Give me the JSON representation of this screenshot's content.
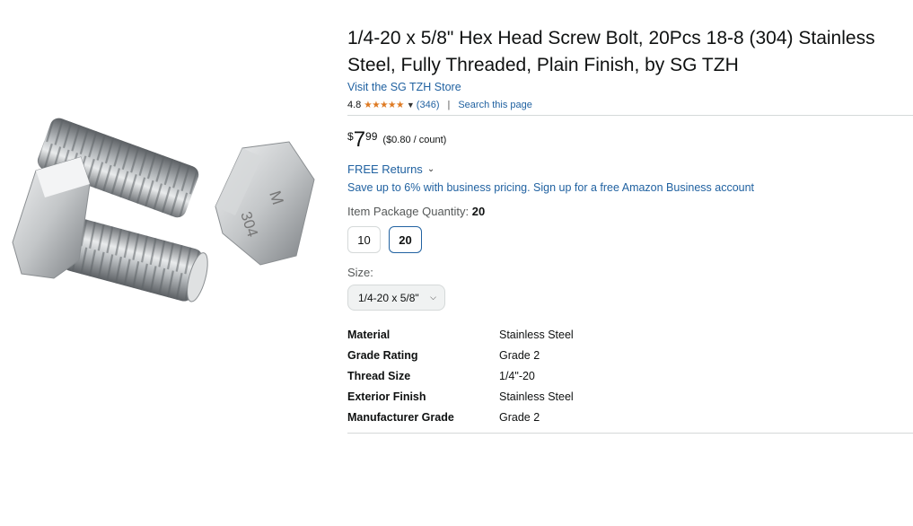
{
  "product": {
    "title": "1/4-20 x 5/8\" Hex Head Screw Bolt, 20Pcs 18-8 (304) Stainless Steel, Fully Threaded, Plain Finish, by SG TZH",
    "store_link": "Visit the SG TZH Store",
    "rating": "4.8",
    "stars": "★★★★★",
    "review_count": "(346)",
    "search_link": "Search this page",
    "image_markings": [
      "M",
      "304"
    ]
  },
  "price": {
    "symbol": "$",
    "whole": "7",
    "fraction": "99",
    "unit_price": "($0.80 / count)"
  },
  "returns": {
    "label": "FREE Returns"
  },
  "business": {
    "text": "Save up to 6% with business pricing. Sign up for a free Amazon Business account"
  },
  "quantity": {
    "label": "Item Package Quantity:",
    "selected": "20",
    "options": [
      "10",
      "20"
    ]
  },
  "size": {
    "label": "Size:",
    "selected": "1/4-20 x 5/8\""
  },
  "specs": [
    {
      "key": "Material",
      "value": "Stainless Steel"
    },
    {
      "key": "Grade Rating",
      "value": "Grade 2"
    },
    {
      "key": "Thread Size",
      "value": "1/4\"-20"
    },
    {
      "key": "Exterior Finish",
      "value": "Stainless Steel"
    },
    {
      "key": "Manufacturer Grade",
      "value": "Grade 2"
    }
  ],
  "icons": {
    "chevron": "chevron-down-icon",
    "stars": "star-rating-icon"
  },
  "colors": {
    "link": "#2162a1",
    "star": "#de7921",
    "text": "#0f1111",
    "selected_border": "#2162a1"
  }
}
